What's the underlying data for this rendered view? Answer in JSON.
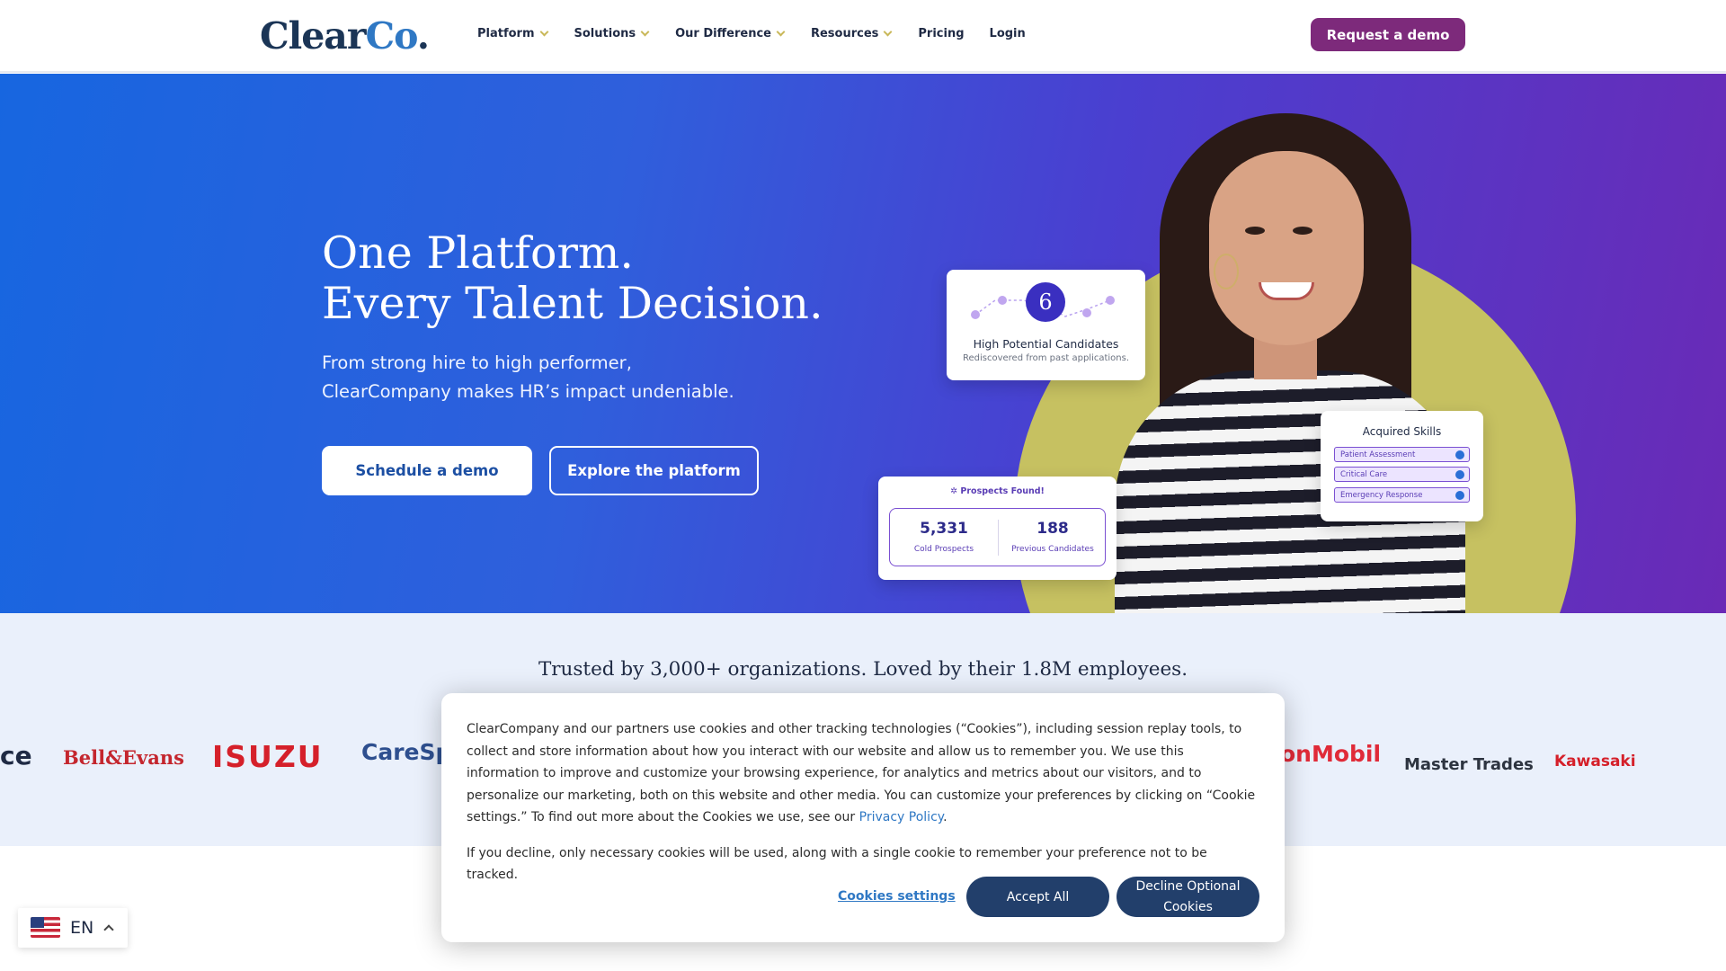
{
  "header": {
    "logo_main": "Clear",
    "logo_co": "Co",
    "logo_dot": ".",
    "nav": [
      {
        "label": "Platform"
      },
      {
        "label": "Solutions"
      },
      {
        "label": "Our Difference"
      },
      {
        "label": "Resources"
      },
      {
        "label": "Pricing"
      },
      {
        "label": "Login"
      }
    ],
    "cta": "Request a demo"
  },
  "hero": {
    "title_line1": "One Platform.",
    "title_line2": "Every Talent Decision.",
    "sub_line1": "From strong hire to high performer,",
    "sub_line2": "ClearCompany makes HR’s impact undeniable.",
    "btn_primary": "Schedule a demo",
    "btn_secondary": "Explore the platform"
  },
  "cards": {
    "high_potential": {
      "number": "6",
      "title": "High Potential Candidates",
      "subtitle": "Rediscovered from past applications."
    },
    "skills": {
      "title": "Acquired Skills",
      "items": [
        "Patient Assessment",
        "Critical Care",
        "Emergency Response"
      ]
    },
    "prospects": {
      "title": "Prospects Found!",
      "cold_value": "5,331",
      "cold_label": "Cold Prospects",
      "prev_value": "188",
      "prev_label": "Previous Candidates"
    }
  },
  "trusted": {
    "title": "Trusted by 3,000+ organizations. Loved by their 1.8M employees.",
    "logos": [
      "ce",
      "Bell&Evans",
      "ISUZU",
      "CareSp",
      "onMobil",
      "Master Trades",
      "Kawasaki"
    ]
  },
  "cookie": {
    "text_a": "ClearCompany and our partners use cookies and other tracking technologies (“Cookies”), including session replay tools, to collect and store information about how you interact with our website and allow us to remember you. We use this information to improve and customize your browsing experience, for analytics and metrics about our visitors, and to personalize our marketing, both on this website and other media. You can customize your preferences by clicking on “Cookie settings.” To find out more about the Cookies we use, see our ",
    "privacy_link": "Privacy Policy",
    "text_b": ".",
    "text2": "If you decline, only necessary cookies will be used, along with a single cookie to remember your preference not to be tracked.",
    "settings": "Cookies settings",
    "accept": "Accept All",
    "decline": "Decline Optional Cookies"
  },
  "language": {
    "label": "EN"
  },
  "colors": {
    "brand_purple": "#7d2a7b",
    "navy_button": "#223f6b",
    "accent_olive": "#c6c161",
    "link_blue": "#2f78c4"
  }
}
